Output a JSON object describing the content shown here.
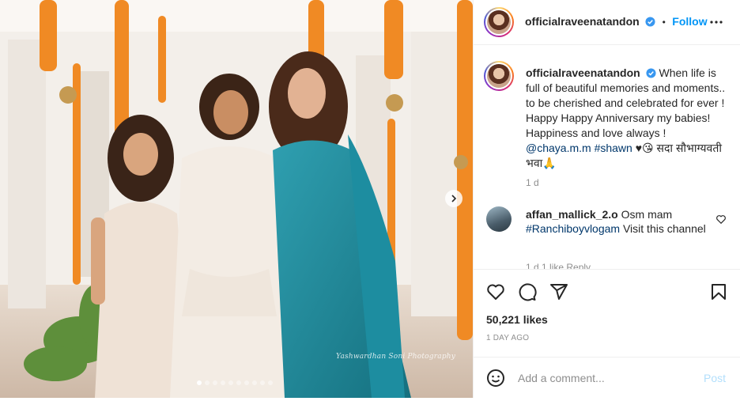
{
  "post": {
    "username": "officialraveenatandon",
    "follow_label": "Follow",
    "separator": "•",
    "watermark": "Yashwardhan Soni Photography",
    "image_count": 10,
    "active_image": 1
  },
  "caption": {
    "username": "officialraveenatandon",
    "line1": "When life is full of beautiful memories and moments.. to be cherished and celebrated for ever ! Happy Happy Anniversary my babies! Happiness and love always !",
    "mention": "@chaya.m.m",
    "hashtag": "#shawn",
    "tail": "♥😘 सदा सौभाग्यवती भवा🙏",
    "time": "1 d"
  },
  "comment": {
    "username": "affan_mallick_2.o",
    "text": "Osm mam",
    "hashtag": "#Ranchiboyvlogam",
    "tail": "Visit this channel",
    "meta": "1 d   1 like   Reply"
  },
  "stats": {
    "likes": "50,221 likes",
    "ago": "1 DAY AGO"
  },
  "composer": {
    "placeholder": "Add a comment...",
    "post_label": "Post"
  },
  "icons": {
    "next": "chevron-right-icon",
    "more": "more-horizontal-icon",
    "verified": "verified-badge-icon",
    "like": "heart-icon",
    "comment": "comment-icon",
    "share": "paper-plane-icon",
    "save": "bookmark-icon",
    "emoji": "emoji-icon"
  },
  "colors": {
    "link": "#0095f6",
    "hashtag": "#00376b",
    "muted": "#8e8e8e",
    "post_disabled": "#b2dffc"
  }
}
